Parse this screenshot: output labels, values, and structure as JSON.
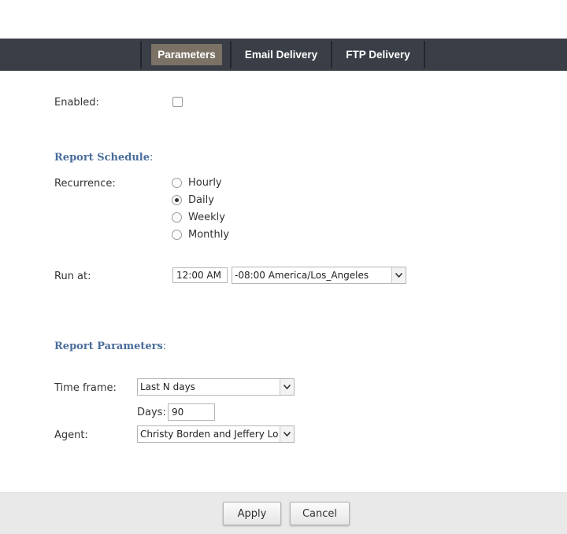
{
  "tabs": {
    "parameters": "Parameters",
    "email_delivery": "Email Delivery",
    "ftp_delivery": "FTP Delivery",
    "active": "Parameters"
  },
  "enabled": {
    "label": "Enabled:",
    "checked": false
  },
  "schedule": {
    "title": "Report Schedule",
    "colon": ":",
    "recurrence_label": "Recurrence:",
    "options": [
      "Hourly",
      "Daily",
      "Weekly",
      "Monthly"
    ],
    "selected": "Daily",
    "run_at_label": "Run at:",
    "time_value": "12:00 AM",
    "timezone_value": "-08:00 America/Los_Angeles"
  },
  "parameters": {
    "title": "Report Parameters",
    "colon": ":",
    "time_frame_label": "Time frame:",
    "time_frame_value": "Last N days",
    "days_label": "Days:",
    "days_value": "90",
    "agent_label": "Agent:",
    "agent_value": "Christy Borden and Jeffery Lozada"
  },
  "footer": {
    "apply_label": "Apply",
    "cancel_label": "Cancel"
  },
  "colors": {
    "tabbar": "#3a3f47",
    "active_tab": "#7b7165",
    "section_title": "#4a6d9b"
  },
  "icons": {
    "dropdown": "chevron-down-icon"
  }
}
